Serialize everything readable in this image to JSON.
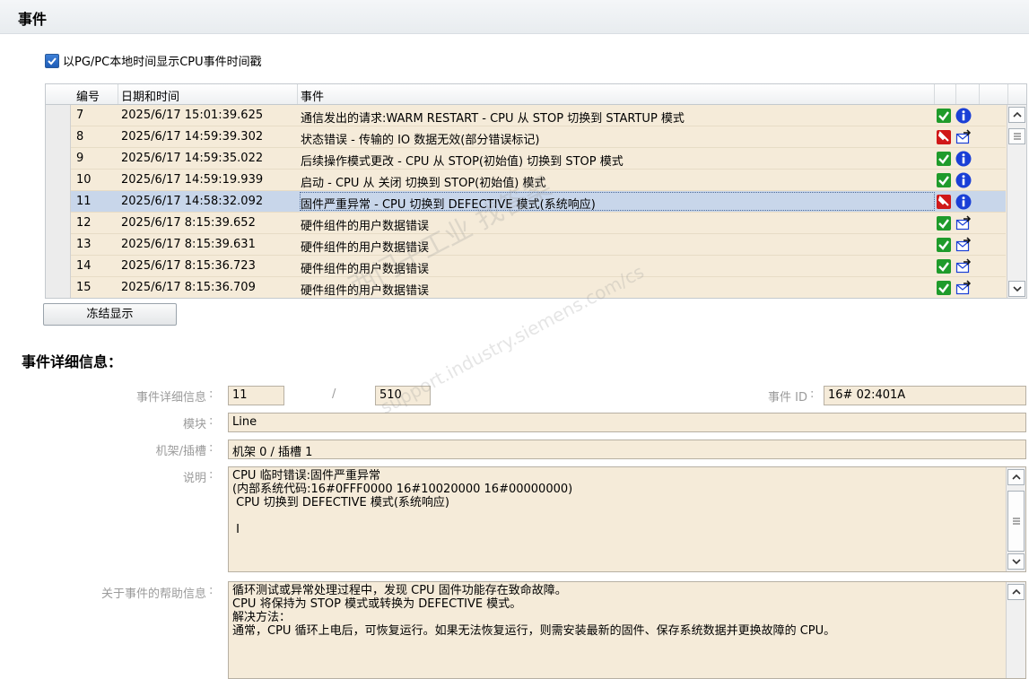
{
  "section": {
    "title": "事件"
  },
  "options": {
    "show_local_time_label": "以PG/PC本地时间显示CPU事件时间戳",
    "show_local_time_checked": true
  },
  "table": {
    "headers": {
      "num": "编号",
      "datetime": "日期和时间",
      "event": "事件"
    },
    "rows": [
      {
        "num": "7",
        "datetime": "2025/6/17 15:01:39.625",
        "event": "通信发出的请求:WARM RESTART - CPU 从 STOP 切换到 STARTUP 模式",
        "icon1": "green-check-icon",
        "icon2": "info-icon"
      },
      {
        "num": "8",
        "datetime": "2025/6/17 14:59:39.302",
        "event": "状态错误 - 传输的 IO 数据无效(部分错误标记)",
        "icon1": "red-error-icon",
        "icon2": "outgoing-event-icon"
      },
      {
        "num": "9",
        "datetime": "2025/6/17 14:59:35.022",
        "event": "后续操作模式更改 - CPU 从 STOP(初始值) 切换到 STOP 模式",
        "icon1": "green-check-icon",
        "icon2": "info-icon"
      },
      {
        "num": "10",
        "datetime": "2025/6/17 14:59:19.939",
        "event": "启动 - CPU 从 关闭 切换到 STOP(初始值) 模式",
        "icon1": "green-check-icon",
        "icon2": "info-icon"
      },
      {
        "num": "11",
        "datetime": "2025/6/17 14:58:32.092",
        "event": "固件严重异常 - CPU 切换到 DEFECTIVE 模式(系统响应)",
        "icon1": "red-error-icon",
        "icon2": "info-icon",
        "selected": true
      },
      {
        "num": "12",
        "datetime": "2025/6/17 8:15:39.652",
        "event": "硬件组件的用户数据错误",
        "icon1": "green-check-icon",
        "icon2": "outgoing-event-icon"
      },
      {
        "num": "13",
        "datetime": "2025/6/17 8:15:39.631",
        "event": "硬件组件的用户数据错误",
        "icon1": "green-check-icon",
        "icon2": "outgoing-event-icon"
      },
      {
        "num": "14",
        "datetime": "2025/6/17 8:15:36.723",
        "event": "硬件组件的用户数据错误",
        "icon1": "green-check-icon",
        "icon2": "outgoing-event-icon"
      },
      {
        "num": "15",
        "datetime": "2025/6/17 8:15:36.709",
        "event": "硬件组件的用户数据错误",
        "icon1": "green-check-icon",
        "icon2": "outgoing-event-icon"
      }
    ]
  },
  "freeze_button": {
    "label": "冻结显示"
  },
  "details": {
    "title": "事件详细信息：",
    "event_details_label": "事件详细信息",
    "event_index": "11",
    "separator": "/",
    "event_total": "510",
    "event_id_label": "事件 ID",
    "event_id": "16# 02:401A",
    "module_label": "模块",
    "module": "Line",
    "rack_slot_label": "机架/插槽",
    "rack_slot": "机架 0 / 插槽 1",
    "description_label": "说明",
    "description_lines": [
      "CPU 临时错误:固件严重异常",
      "(内部系统代码:16#0FFF0000 16#10020000 16#00000000)",
      " CPU 切换到 DEFECTIVE 模式(系统响应)",
      "",
      " I"
    ],
    "help_label": "关于事件的帮助信息",
    "help_lines": [
      "循环测试或异常处理过程中，发现 CPU 固件功能存在致命故障。",
      "CPU 将保持为 STOP 模式或转换为 DEFECTIVE 模式。",
      "解决方法：",
      "通常，CPU 循环上电后，可恢复运行。如果无法恢复运行，则需安装最新的固件、保存系统数据并更换故障的 CPU。"
    ]
  },
  "watermark": {
    "line1": "西门子工业  找答案",
    "line2": "support.industry.siemens.com/cs"
  },
  "colors": {
    "field_bg": "#f5ebd9",
    "selected_row": "#c8d6ea",
    "ok_green": "#1f9b2b",
    "info_blue": "#1a3fd6",
    "error_red": "#d01818"
  }
}
